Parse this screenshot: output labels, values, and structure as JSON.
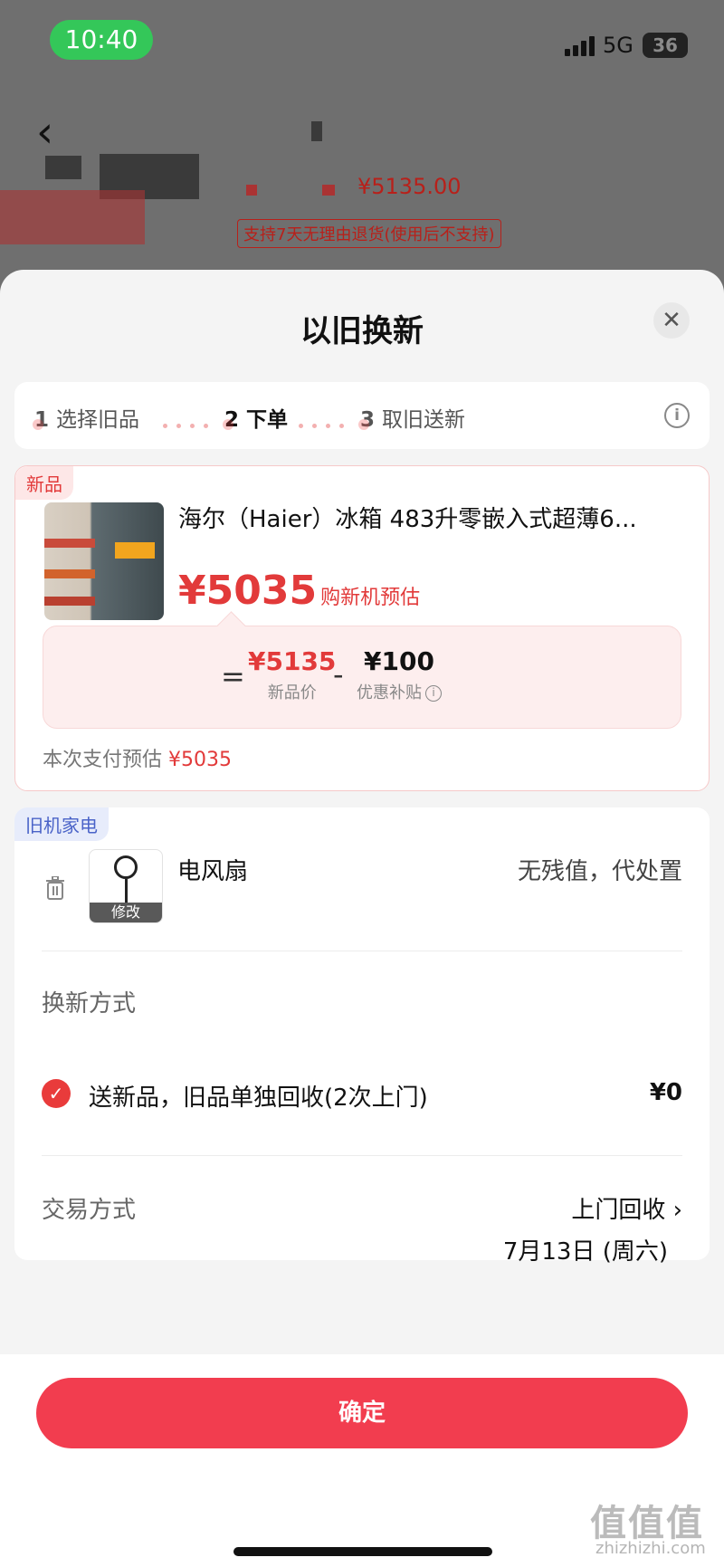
{
  "status_bar": {
    "time": "10:40",
    "network": "5G",
    "battery": "36"
  },
  "background_page": {
    "price": "¥5135.00",
    "return_policy": "支持7天无理由退货(使用后不支持)"
  },
  "sheet": {
    "title": "以旧换新",
    "close_glyph": "✕",
    "steps": [
      {
        "num": "1",
        "label": "选择旧品"
      },
      {
        "num": "2",
        "label": "下单"
      },
      {
        "num": "3",
        "label": "取旧送新"
      }
    ],
    "info_glyph": "i"
  },
  "new_product": {
    "tag": "新品",
    "name": "海尔（Haier）冰箱 483升零嵌入式超薄6...",
    "estimate_price": "¥5035",
    "estimate_caption": "购新机预估",
    "equals": "=",
    "new_price": "¥5135",
    "new_price_label": "新品价",
    "minus": "-",
    "subsidy": "¥100",
    "subsidy_label": "优惠补贴",
    "pay_estimate_label": "本次支付预估",
    "pay_estimate_value": "¥5035"
  },
  "old_appliance": {
    "tag": "旧机家电",
    "name": "电风扇",
    "value_text": "无残值，代处置",
    "modify_label": "修改",
    "exchange_method_label": "换新方式",
    "option_text": "送新品，旧品单独回收(2次上门)",
    "option_price": "¥0",
    "check_glyph": "✓",
    "trade_method_label": "交易方式",
    "trade_method_value": "上门回收 ›",
    "trade_date": "7月13日 (周六)"
  },
  "footer": {
    "confirm_label": "确定"
  },
  "watermark": {
    "main": "值值值",
    "sub": "zhizhizhi.com"
  },
  "colors": {
    "accent": "#f23d4f",
    "price_red": "#e23a3a",
    "status_green": "#34c759",
    "old_tag_blue": "#4a63c8"
  }
}
